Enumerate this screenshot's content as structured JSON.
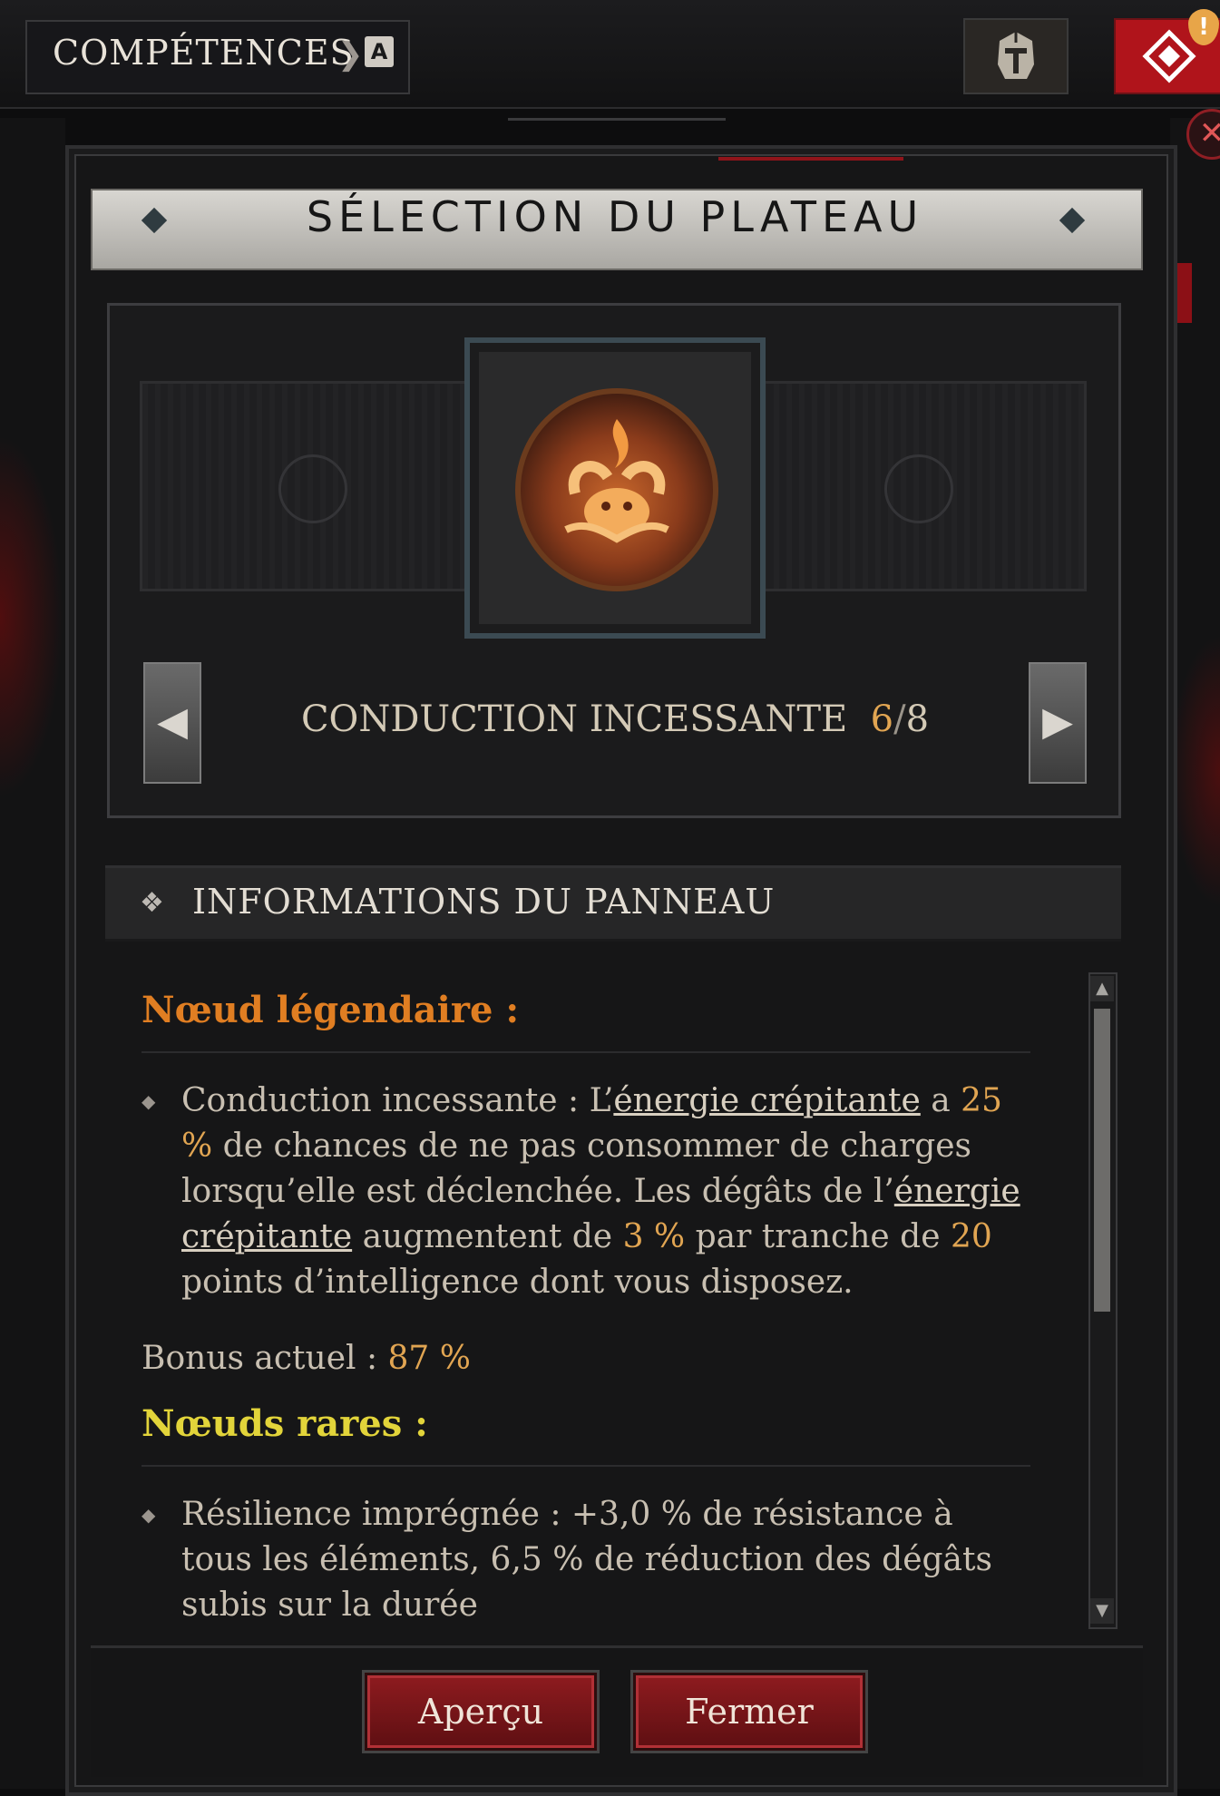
{
  "topbar": {
    "title": "COMPÉTENCES",
    "key_hint": "A",
    "alert": "!"
  },
  "dialog": {
    "title": "SÉLECTION DU PLATEAU",
    "board": {
      "name": "CONDUCTION INCESSANTE",
      "current": "6",
      "separator": "/",
      "total": "8"
    },
    "info_header": "INFORMATIONS DU PANNEAU",
    "legendary": {
      "title": "Nœud légendaire :",
      "name": "Conduction incessante : L’",
      "link1": "énergie crépitante",
      "t1": " a ",
      "p1": "25 %",
      "t2": " de chances de ne pas consommer de charges lorsqu’elle est déclenchée. Les dégâts de l’",
      "link2": "énergie crépitante",
      "t3": " augmentent de ",
      "p2": "3 %",
      "t4": " par tranche de ",
      "p3": "20",
      "t5": " points d’intelligence dont vous disposez."
    },
    "bonus": {
      "label": "Bonus actuel : ",
      "value": "87 %"
    },
    "rare": {
      "title": "Nœuds rares :",
      "item1": "Résilience imprégnée : +3,0 % de résistance à tous les éléments, 6,5 % de réduction des dégâts subis sur la durée"
    },
    "buttons": {
      "preview": "Aperçu",
      "close": "Fermer"
    }
  },
  "colors": {
    "accent_red": "#8e1b1f",
    "legendary_orange": "#e07e22",
    "rare_yellow": "#e2d43a",
    "highlight_value": "#e1a552"
  },
  "icons": {
    "helm": "helm-icon",
    "diamond": "diamond-icon",
    "alert": "alert-icon",
    "close": "close-icon",
    "emblem": "fire-ram-emblem-icon"
  }
}
